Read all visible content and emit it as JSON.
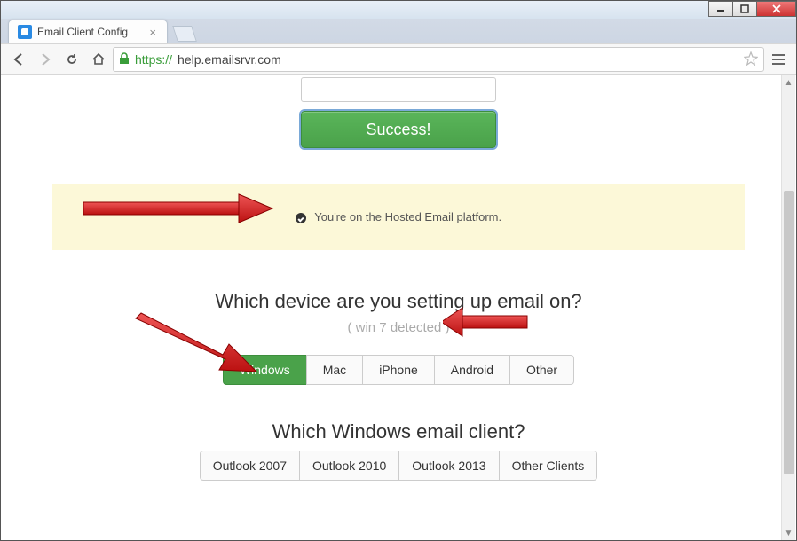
{
  "window": {
    "tab_title": "Email Client Config"
  },
  "toolbar": {
    "url_protocol": "https://",
    "url_host": "help.emailsrvr.com"
  },
  "page": {
    "success_button": "Success!",
    "alert_text": "You're on the Hosted Email platform.",
    "question_device": "Which device are you setting up email on?",
    "detected_text": "( win 7 detected )",
    "device_options": [
      "Windows",
      "Mac",
      "iPhone",
      "Android",
      "Other"
    ],
    "device_active_index": 0,
    "question_client": "Which Windows email client?",
    "client_options": [
      "Outlook 2007",
      "Outlook 2010",
      "Outlook 2013",
      "Other Clients"
    ]
  }
}
